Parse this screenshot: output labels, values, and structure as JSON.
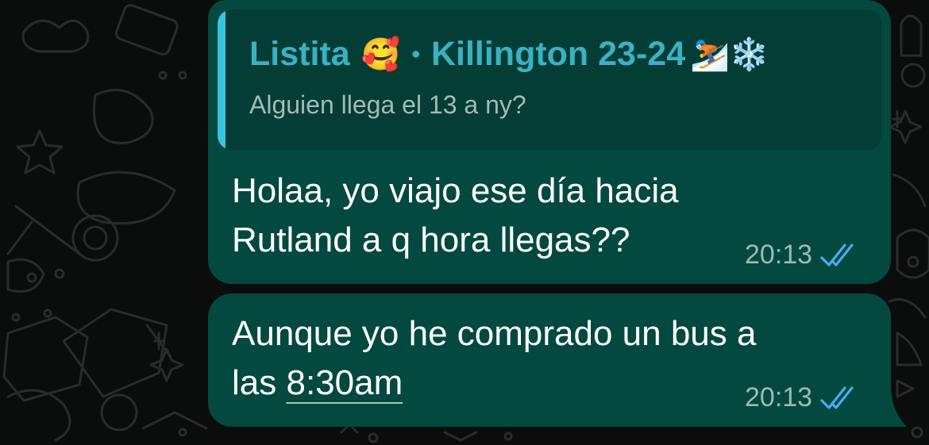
{
  "colors": {
    "background": "#0b0c0c",
    "bubble": "#03493f",
    "quote_background": "#033d35",
    "quote_bar": "#36c5dc",
    "quote_sender": "#3ab1c2",
    "read_ticks": "#4aa9f2"
  },
  "quote": {
    "sender_name": "Listita",
    "sender_emoji": "🥰",
    "separator": "•",
    "group_name": "Killington 23-24",
    "group_emojis": "⛷️❄️",
    "text": "Alguien llega el 13 a ny?"
  },
  "messages": [
    {
      "line1": "Holaa, yo viajo ese día hacia",
      "line2": "Rutland a q hora llegas??",
      "time": "20:13",
      "status_icon": "double-check-icon"
    },
    {
      "line1": "Aunque yo he comprado un bus a",
      "line2_prefix": "las ",
      "line2_link": "8:30am",
      "time": "20:13",
      "status_icon": "double-check-icon"
    }
  ]
}
